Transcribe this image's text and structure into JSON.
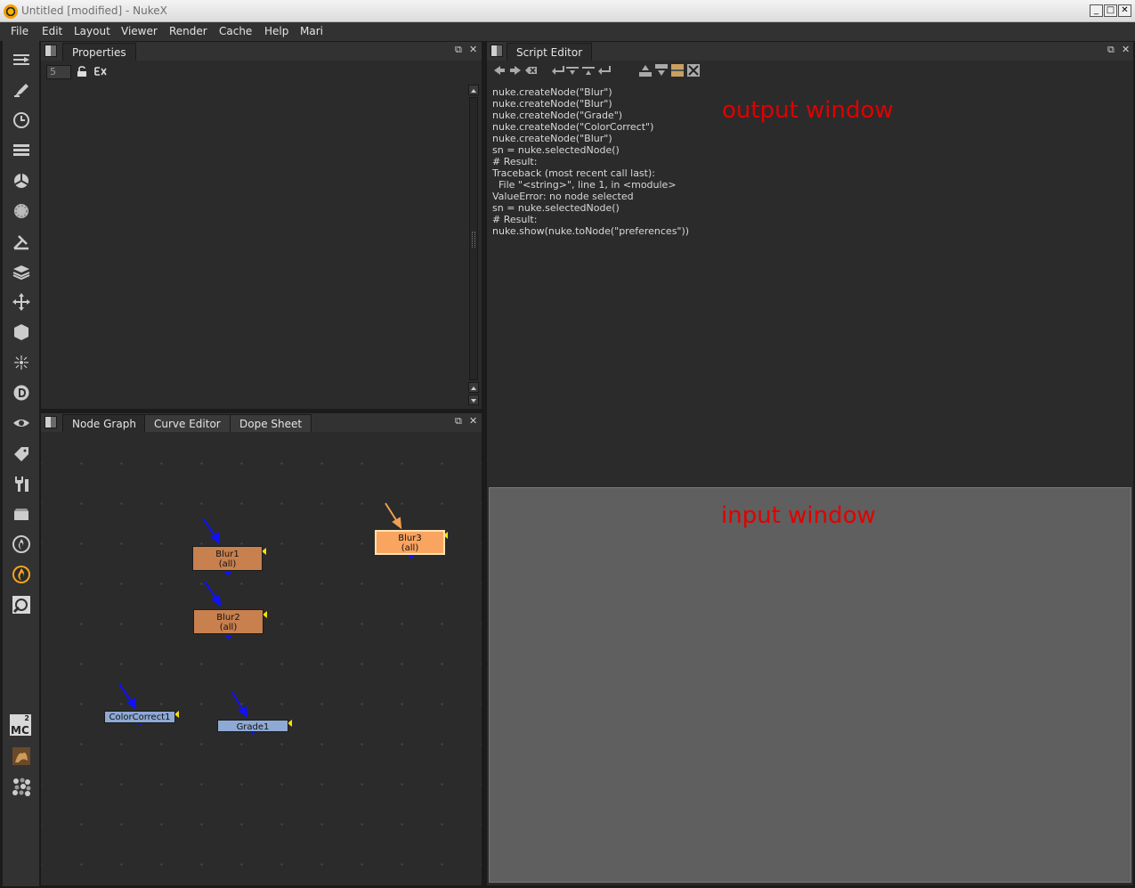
{
  "window": {
    "title": "Untitled [modified] - NukeX",
    "minimize_glyph": "_",
    "maximize_glyph": "□",
    "close_glyph": "✕"
  },
  "menubar": {
    "items": [
      "File",
      "Edit",
      "Layout",
      "Viewer",
      "Render",
      "Cache",
      "Help",
      "Mari"
    ]
  },
  "toolbar": {
    "icons": [
      "input-output-icon",
      "paint-brush-icon",
      "time-icon",
      "channel-icon",
      "color-wheel-icon",
      "filter-icon",
      "keyer-icon",
      "merge-icon",
      "transform-icon",
      "3d-cube-icon",
      "particles-icon",
      "deep-icon",
      "views-icon",
      "metadata-tag-icon",
      "toolsets-wrench-icon",
      "other-icon",
      "furnace-icon",
      "nukex-flame-icon",
      "ocula-icon"
    ],
    "bottom_label": "MC",
    "bottom_superscript": "2"
  },
  "properties_panel": {
    "tab_label": "Properties",
    "max_panels_value": "5",
    "float_glyph": "⧉",
    "close_glyph": "✕"
  },
  "node_graph_panel": {
    "tabs": [
      {
        "label": "Node Graph",
        "active": true
      },
      {
        "label": "Curve Editor",
        "active": false
      },
      {
        "label": "Dope Sheet",
        "active": false
      }
    ],
    "float_glyph": "⧉",
    "close_glyph": "✕",
    "nodes": [
      {
        "name": "Blur1",
        "sub": "(all)",
        "type": "blur",
        "selected": false
      },
      {
        "name": "Blur2",
        "sub": "(all)",
        "type": "blur",
        "selected": false
      },
      {
        "name": "Blur3",
        "sub": "(all)",
        "type": "blur",
        "selected": true
      },
      {
        "name": "ColorCorrect1",
        "sub": "",
        "type": "color",
        "selected": false
      },
      {
        "name": "Grade1",
        "sub": "",
        "type": "color",
        "selected": false
      }
    ]
  },
  "script_editor_panel": {
    "tab_label": "Script Editor",
    "float_glyph": "⧉",
    "close_glyph": "✕",
    "output_lines": [
      "nuke.createNode(\"Blur\")",
      "nuke.createNode(\"Blur\")",
      "nuke.createNode(\"Grade\")",
      "nuke.createNode(\"ColorCorrect\")",
      "nuke.createNode(\"Blur\")",
      "sn = nuke.selectedNode()",
      "# Result:",
      "Traceback (most recent call last):",
      "  File \"<string>\", line 1, in <module>",
      "ValueError: no node selected",
      "sn = nuke.selectedNode()",
      "# Result:",
      "nuke.show(nuke.toNode(\"preferences\"))"
    ],
    "output_label": "output window",
    "input_label": "input window"
  },
  "colors": {
    "background": "#2b2b2b",
    "input_window": "#5f5f5f",
    "blur_node": "#c8804f",
    "selected_node": "#f9a45f",
    "color_node": "#8ea9d4",
    "annotation": "#e00000",
    "input_arrow": "#1010ff",
    "selected_arrow": "#f0a050"
  }
}
